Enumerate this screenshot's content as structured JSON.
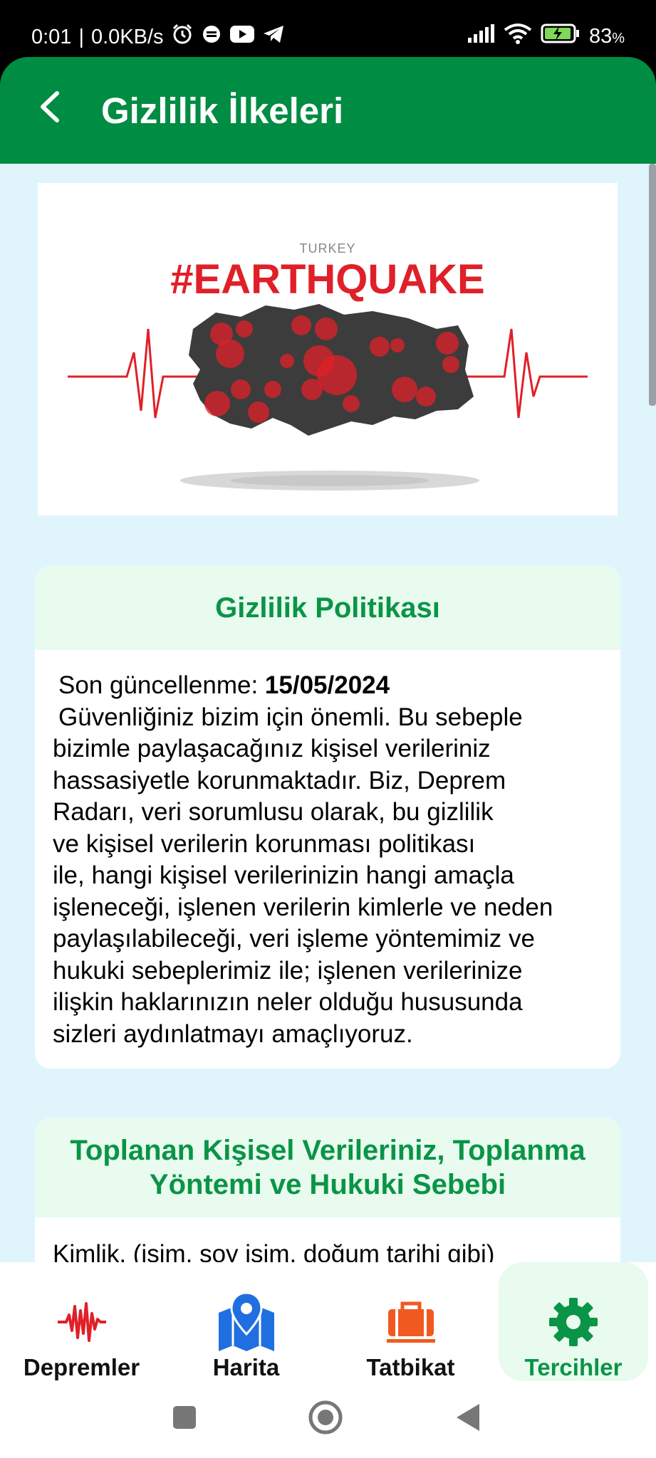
{
  "status_bar": {
    "time": "0:01",
    "separator": "|",
    "speed": "0.0KB/s",
    "battery": "83",
    "battery_unit": "%",
    "icons": [
      "alarm-icon",
      "chat-icon",
      "youtube-icon",
      "telegram-icon",
      "signal-icon",
      "wifi-icon",
      "battery-charging-icon"
    ]
  },
  "app_bar": {
    "title": "Gizlilik İlkeleri",
    "back_icon": "chevron-left-icon",
    "color": "#008c42"
  },
  "banner": {
    "country": "TURKEY",
    "hashtag": "#EARTHQUAKE"
  },
  "privacy_card": {
    "heading": "Gizlilik Politikası",
    "updated_label": "Son güncellenme: ",
    "updated_date": "15/05/2024",
    "lines": [
      "Güvenliğiniz bizim için önemli. Bu sebeple",
      "bizimle paylaşacağınız kişisel verileriniz",
      "hassasiyetle korunmaktadır. Biz, Deprem",
      "Radarı, veri sorumlusu olarak, bu gizlilik",
      "ve kişisel verilerin korunması politikası",
      "ile, hangi kişisel verilerinizin hangi amaçla",
      "işleneceği, işlenen verilerin kimlerle ve neden",
      "paylaşılabileceği, veri işleme yöntemimiz ve",
      "hukuki sebeplerimiz ile; işlenen verilerinize",
      "ilişkin haklarınızın neler olduğu hususunda",
      "sizleri aydınlatmayı amaçlıyoruz."
    ]
  },
  "data_card": {
    "heading_line1": "Toplanan Kişisel Verileriniz, Toplanma",
    "heading_line2": "Yöntemi ve Hukuki Sebebi",
    "first_line": "Kimlik, (isim, soy isim, doğum tarihi gibi)"
  },
  "bottom_nav": {
    "items": [
      {
        "label": "Depremler",
        "icon": "seismograph-icon",
        "active": false
      },
      {
        "label": "Harita",
        "icon": "map-pin-icon",
        "active": false
      },
      {
        "label": "Tatbikat",
        "icon": "briefcase-icon",
        "active": false
      },
      {
        "label": "Tercihler",
        "icon": "gear-icon",
        "active": true
      }
    ]
  },
  "colors": {
    "accent": "#0a9447",
    "content_bg": "#e0f5fb",
    "card_head_bg": "#e8fbee"
  }
}
